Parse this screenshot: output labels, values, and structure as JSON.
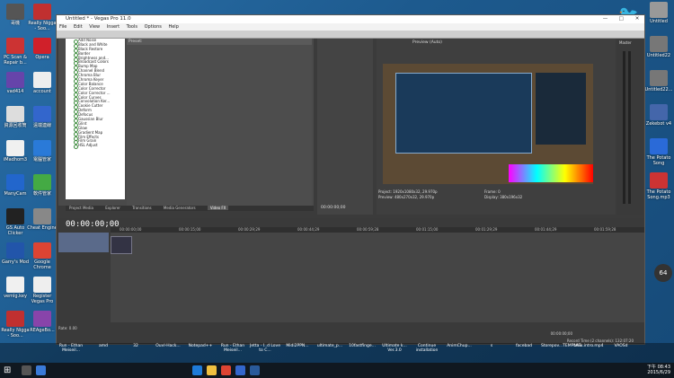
{
  "desktop_icons_left": [
    {
      "label": "哥機",
      "color": "#555555"
    },
    {
      "label": "Really Nigga - Soo...",
      "color": "#c03030"
    },
    {
      "label": "PC Scan & Repair b...",
      "color": "#cc3333"
    },
    {
      "label": "Opera",
      "color": "#d0202a"
    },
    {
      "label": "vad414",
      "color": "#6644aa"
    },
    {
      "label": "account",
      "color": "#eeeeee"
    },
    {
      "label": "資源回收筒",
      "color": "#dddddd"
    },
    {
      "label": "遠端連線",
      "color": "#3366cc"
    },
    {
      "label": "iMadhom3",
      "color": "#f0f0f0"
    },
    {
      "label": "電腦管家",
      "color": "#2a7ad8"
    },
    {
      "label": "ManyCam",
      "color": "#2266cc"
    },
    {
      "label": "軟件管家",
      "color": "#44aa44"
    },
    {
      "label": "GS Auto Clicker",
      "color": "#222222"
    },
    {
      "label": "Cheat Engine",
      "color": "#888888"
    },
    {
      "label": "Garry's Mod",
      "color": "#2255aa"
    },
    {
      "label": "Google Chrome",
      "color": "#dd4433"
    },
    {
      "label": "vemlg.key",
      "color": "#f0f0f0"
    },
    {
      "label": "Register Vegas Pro",
      "color": "#eeeeee"
    },
    {
      "label": "Really Nigga - Soo...",
      "color": "#c03030"
    },
    {
      "label": "REAgeBo...",
      "color": "#8844aa"
    }
  ],
  "desktop_icons_right": [
    {
      "label": "Untitled",
      "color": "#999999"
    },
    {
      "label": "Untitled22",
      "color": "#777777"
    },
    {
      "label": "Untitled22...",
      "color": "#777777"
    },
    {
      "label": "Zekebot v4",
      "color": "#4466aa"
    },
    {
      "label": "The Potato Song",
      "color": "#2a6ad8"
    },
    {
      "label": "The Potato Song.mp3",
      "color": "#cc3333"
    }
  ],
  "window": {
    "title": "Untitled * - Vegas Pro 11.0",
    "menu": [
      "File",
      "Edit",
      "View",
      "Insert",
      "Tools",
      "Options",
      "Help"
    ],
    "presets_label": "Preset:",
    "video_fx": [
      "Add Noise",
      "Black and White",
      "Black Restore",
      "Border",
      "Brightness and...",
      "Broadcast Colors",
      "Bump Map",
      "Channel Blend",
      "Chroma Blur",
      "Chroma Keyer",
      "Color Balance",
      "Color Corrector",
      "Color Corrector ...",
      "Color Curves",
      "Convolution Ker...",
      "Cookie Cutter",
      "Deform",
      "Defocus",
      "Gaussian Blur",
      "Glint",
      "Glow",
      "Gradient Map",
      "Film Effects",
      "Film Grain",
      "HSL Adjust"
    ],
    "tabs": [
      "Project Media",
      "Explorer",
      "Transitions",
      "Media Generators",
      "Video FX"
    ],
    "active_tab": "Video FX",
    "trimmer_timecode": "00:00:00;00",
    "preview_label": "Preview (Auto)",
    "project_info": "Project: 1920x1080x32, 29.970p",
    "preview_info": "Preview: 480x270x32, 29.970p",
    "frame_label": "Frame: 0",
    "display_label": "Display: 380x196x32",
    "master_label": "Master",
    "timeline_timecode": "00:00:00;00",
    "rate_label": "Rate: 0.00",
    "record_time": "Record Time (2 channels): 132:07:20",
    "end_timecode": "00:00:00;00",
    "ruler_ticks": [
      "00:00:00;00",
      "00:00:15;00",
      "00:00:29;29",
      "00:00:44;29",
      "00:00:59;28",
      "00:01:15;00",
      "00:01:29;29",
      "00:01:44;29",
      "00:01:59;28"
    ]
  },
  "thumb_strip": [
    "Run - Ethan Meiseil...",
    "amd",
    "32",
    "Ouvl-Hack...",
    "Notepad++",
    "Run - Ethan Meiseil...",
    "Jetta - I..d Love to C...",
    "Midi2PPN...",
    "ultimate_p...",
    "10fastfinge...",
    "Ultimate k... Ver.3.0",
    "Continue installation",
    "AnimChup...",
    "s",
    "facebad",
    "Storepov...TEMPLAT...",
    "New intro.mp4",
    "VAOSd"
  ],
  "side_overlay": {
    "value": "64",
    "units": "%"
  },
  "taskbar": {
    "time": "下午 08:43",
    "date": "2015/6/29"
  },
  "colors": {
    "accent": "#2a6fa8",
    "vegas_bg": "#3b3b3b",
    "fx_icon": "#3a8a3a"
  }
}
